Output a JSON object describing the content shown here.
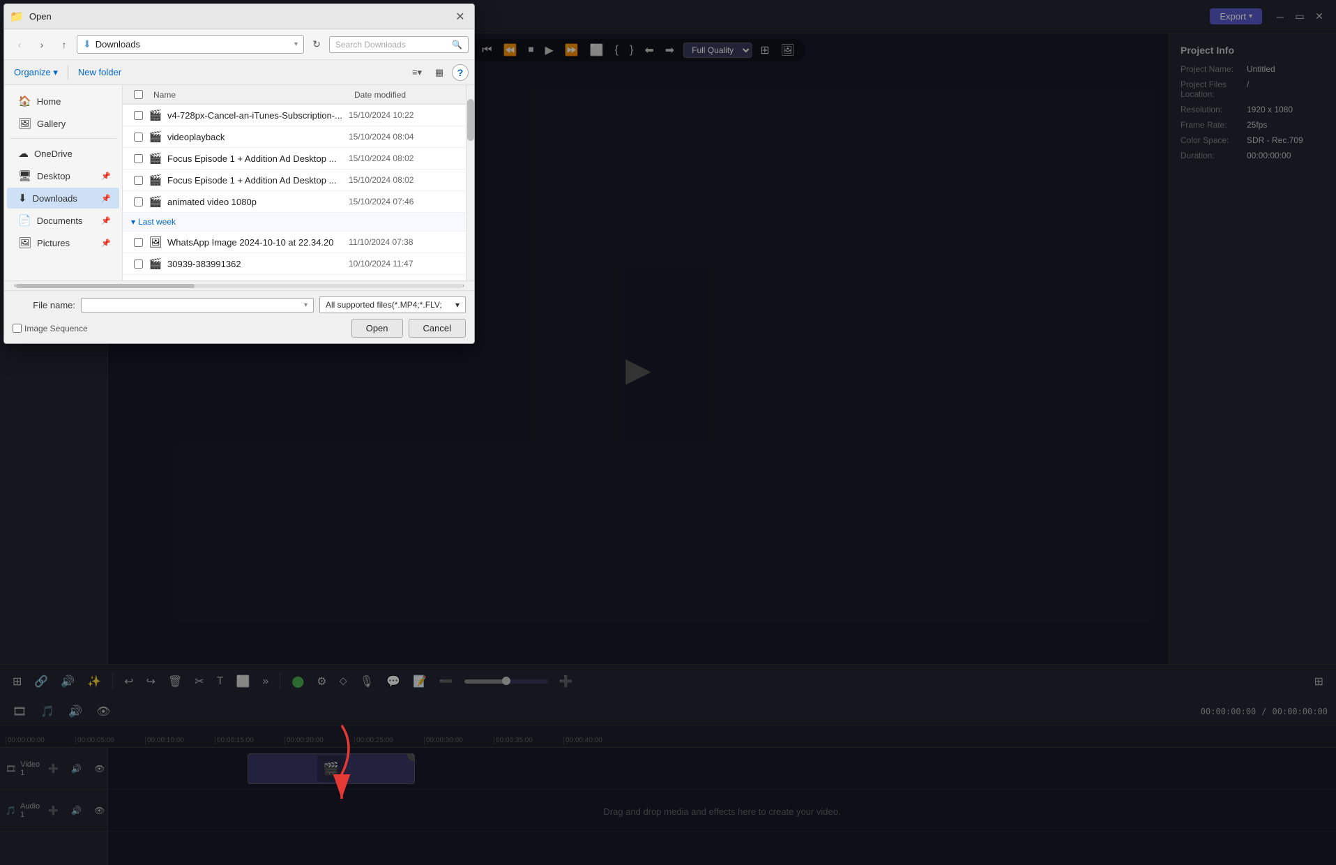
{
  "dialog": {
    "title": "Open",
    "title_icon": "📁",
    "addressbar": {
      "path": "Downloads",
      "path_icon": "⬇",
      "search_placeholder": "Search Downloads"
    },
    "toolbar": {
      "organize": "Organize",
      "organize_arrow": "▾",
      "new_folder": "New folder"
    },
    "columns": {
      "name": "Name",
      "date_modified": "Date modified"
    },
    "sections": {
      "last_week_label": "Last week"
    },
    "files": [
      {
        "id": 1,
        "name": "v4-728px-Cancel-an-iTunes-Subscription-...",
        "date": "15/10/2024 10:22",
        "icon": "🎬",
        "checked": false
      },
      {
        "id": 2,
        "name": "videoplayback",
        "date": "15/10/2024 08:04",
        "icon": "🎬",
        "checked": false
      },
      {
        "id": 3,
        "name": "Focus Episode 1 + Addition Ad Desktop ...",
        "date": "15/10/2024 08:02",
        "icon": "🎬",
        "checked": false
      },
      {
        "id": 4,
        "name": "Focus Episode 1 + Addition Ad Desktop ...",
        "date": "15/10/2024 08:02",
        "icon": "🎬",
        "checked": false
      },
      {
        "id": 5,
        "name": "animated video 1080p",
        "date": "15/10/2024 07:46",
        "icon": "🎬",
        "checked": false
      }
    ],
    "last_week_files": [
      {
        "id": 6,
        "name": "WhatsApp Image 2024-10-10 at 22.34.20",
        "date": "11/10/2024 07:38",
        "icon": "🖼",
        "checked": false
      },
      {
        "id": 7,
        "name": "30939-383991362",
        "date": "10/10/2024 11:47",
        "icon": "🎬",
        "checked": false
      }
    ],
    "footer": {
      "file_name_label": "File name:",
      "file_name_value": "",
      "file_type": "All supported files(*.MP4;*.FLV;",
      "file_type_arrow": "▾",
      "image_sequence_label": "Image Sequence",
      "open_label": "Open",
      "cancel_label": "Cancel"
    }
  },
  "sidebar_nav": {
    "items": [
      {
        "label": "Home",
        "icon": "🏠"
      },
      {
        "label": "Gallery",
        "icon": "🖼"
      },
      {
        "label": "OneDrive",
        "icon": "☁"
      },
      {
        "label": "Desktop",
        "icon": "🖥",
        "pinned": true
      },
      {
        "label": "Downloads",
        "icon": "⬇",
        "active": true,
        "pinned": true
      },
      {
        "label": "Documents",
        "icon": "📄",
        "pinned": true
      },
      {
        "label": "Pictures",
        "icon": "🖼",
        "pinned": true
      }
    ]
  },
  "editor": {
    "export_label": "Export",
    "quality": "Full Quality",
    "project_info": {
      "title": "Project Info",
      "name_label": "Project Name:",
      "name_value": "Untitled",
      "files_label": "Project Files",
      "files_sub": "Location:",
      "files_value": "/",
      "resolution_label": "Resolution:",
      "resolution_value": "1920 x 1080",
      "frame_rate_label": "Frame Rate:",
      "frame_rate_value": "25fps",
      "color_space_label": "Color Space:",
      "color_space_value": "SDR - Rec.709",
      "duration_label": "Duration:",
      "duration_value": "00:00:00:00"
    },
    "timeline": {
      "time_current": "00:00:00:00",
      "time_total": "00:00:00:00",
      "ticks": [
        "00:00:00:00",
        "00:00:05:00",
        "00:00:10:00",
        "00:00:15:00",
        "00:00:20:00",
        "00:00:25:00",
        "00:00:30:00",
        "00:00:35:00",
        "00:00:40:00"
      ],
      "drop_text": "Drag and drop media and effects here to create your video.",
      "video_track": "Video 1",
      "audio_track": "Audio 1"
    }
  }
}
